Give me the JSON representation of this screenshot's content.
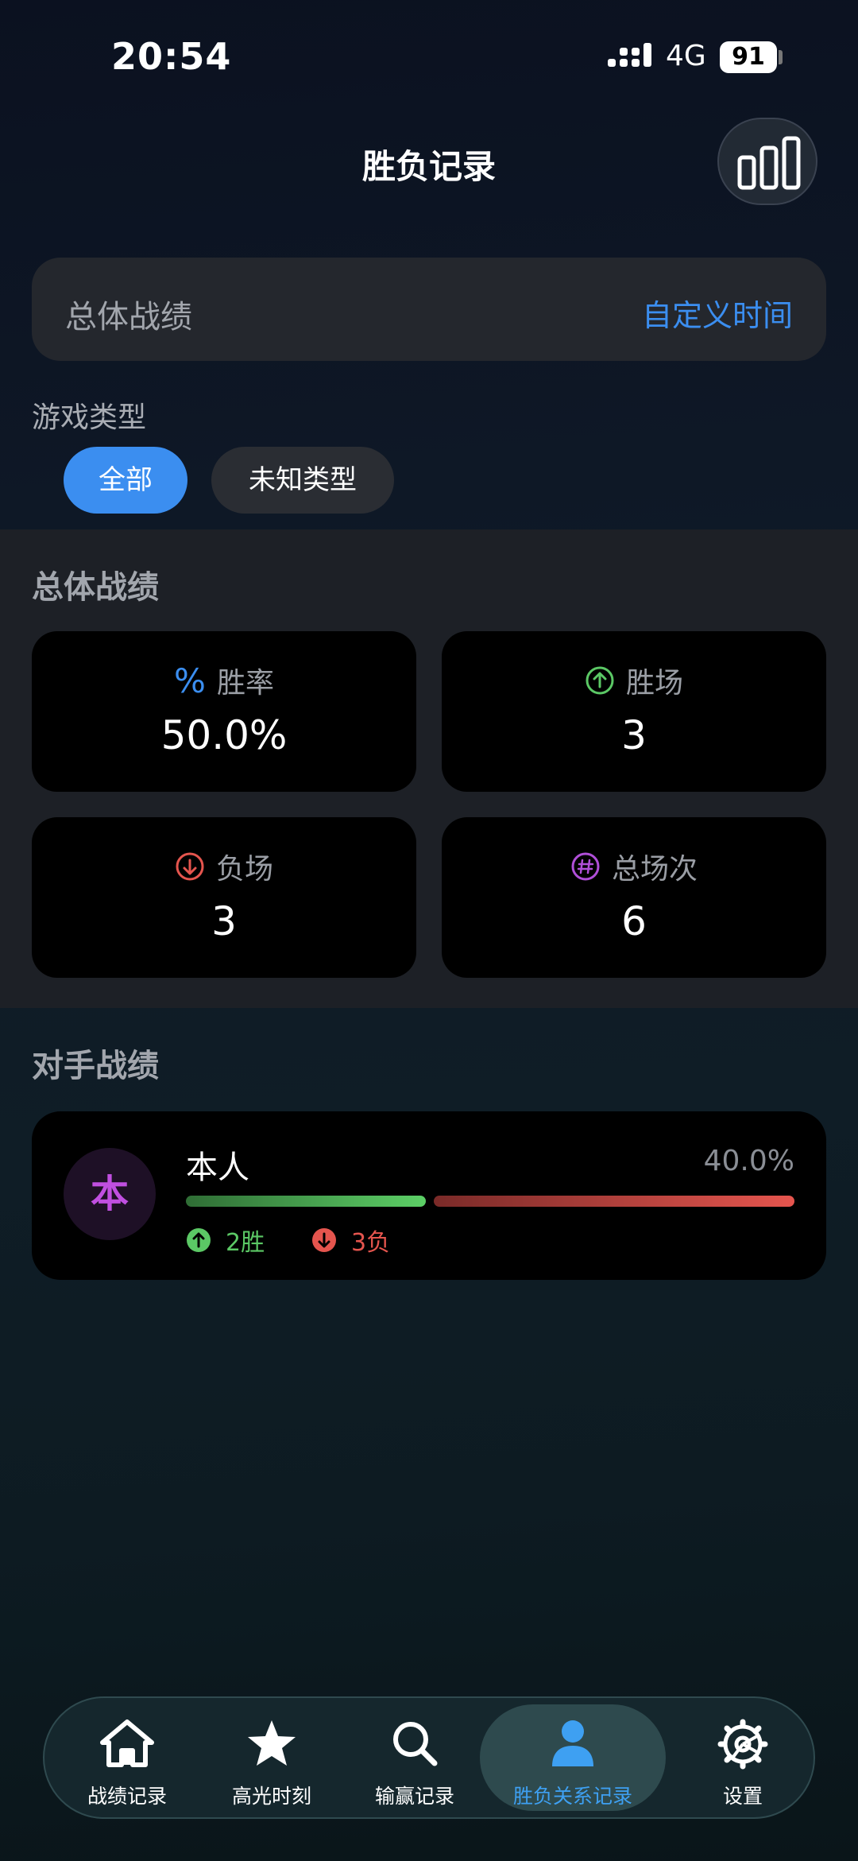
{
  "status_bar": {
    "time": "20:54",
    "network": "4G",
    "battery": "91"
  },
  "header": {
    "title": "胜负记录",
    "chart_button_icon": "bar-chart-icon"
  },
  "summary": {
    "title": "总体战绩",
    "custom_time_link": "自定义时间"
  },
  "game_type": {
    "label": "游戏类型",
    "chips": [
      "全部",
      "未知类型"
    ],
    "selected": "全部"
  },
  "stats": {
    "title": "总体战绩",
    "cards": [
      {
        "icon": "percent-icon",
        "icon_glyph": "%",
        "color": "#3b8ef0",
        "label": "胜率",
        "value": "50.0%"
      },
      {
        "icon": "arrow-up-circle-icon",
        "color": "#5bc865",
        "label": "胜场",
        "value": "3"
      },
      {
        "icon": "arrow-down-circle-icon",
        "color": "#e5554e",
        "label": "负场",
        "value": "3"
      },
      {
        "icon": "hash-circle-icon",
        "color": "#b04fd8",
        "label": "总场次",
        "value": "6"
      }
    ]
  },
  "opponents": {
    "title": "对手战绩",
    "items": [
      {
        "avatar": "本",
        "name": "本人",
        "win_rate": "40.0%",
        "wins": "2胜",
        "losses": "3负",
        "win_fraction": 0.4
      }
    ]
  },
  "bottom_nav": {
    "items": [
      {
        "icon": "home-icon",
        "label": "战绩记录"
      },
      {
        "icon": "star-icon",
        "label": "高光时刻"
      },
      {
        "icon": "search-icon",
        "label": "输赢记录"
      },
      {
        "icon": "person-icon",
        "label": "胜负关系记录",
        "active": true
      },
      {
        "icon": "settings-icon",
        "label": "设置"
      }
    ]
  },
  "colors": {
    "accent": "#3b8ef0",
    "win": "#5bc865",
    "loss": "#e5554e",
    "total": "#b04fd8",
    "nav_active": "#3ea0f2"
  }
}
